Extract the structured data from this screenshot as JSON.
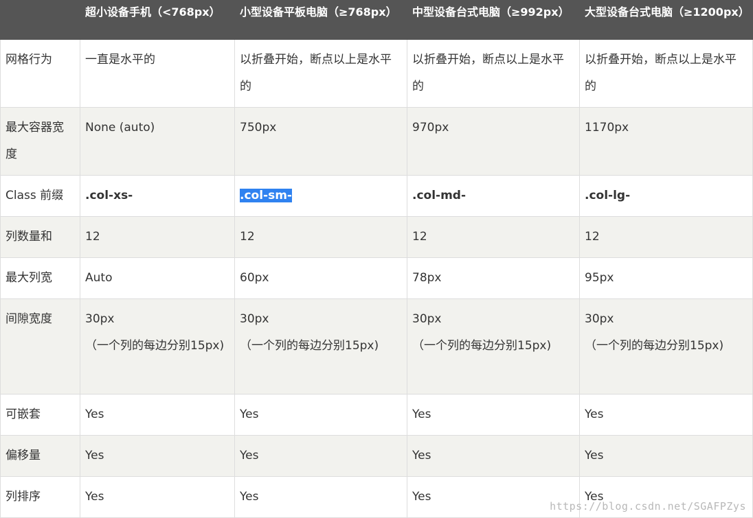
{
  "table": {
    "headers": [
      "",
      "超小设备手机（<768px）",
      "小型设备平板电脑（≥768px）",
      "中型设备台式电脑（≥992px）",
      "大型设备台式电脑（≥1200px）"
    ],
    "rows": [
      {
        "label": "网格行为",
        "cells": [
          "一直是水平的",
          "以折叠开始，断点以上是水平的",
          "以折叠开始，断点以上是水平的",
          "以折叠开始，断点以上是水平的"
        ]
      },
      {
        "label": "最大容器宽度",
        "cells": [
          "None (auto)",
          "750px",
          "970px",
          "1170px"
        ]
      },
      {
        "label": "Class 前缀",
        "cells": [
          ".col-xs-",
          ".col-sm-",
          ".col-md-",
          ".col-lg-"
        ],
        "selected_cell": ".col-sm-"
      },
      {
        "label": "列数量和",
        "cells": [
          "12",
          "12",
          "12",
          "12"
        ]
      },
      {
        "label": "最大列宽",
        "cells": [
          "Auto",
          "60px",
          "78px",
          "95px"
        ]
      },
      {
        "label": "间隙宽度",
        "cells": [
          "30px",
          "30px",
          "30px",
          "30px"
        ],
        "sub": "（一个列的每边分别15px)"
      },
      {
        "label": "可嵌套",
        "cells": [
          "Yes",
          "Yes",
          "Yes",
          "Yes"
        ]
      },
      {
        "label": "偏移量",
        "cells": [
          "Yes",
          "Yes",
          "Yes",
          "Yes"
        ]
      },
      {
        "label": "列排序",
        "cells": [
          "Yes",
          "Yes",
          "Yes",
          "Yes"
        ]
      }
    ]
  },
  "watermark": "https://blog.csdn.net/SGAFPZys",
  "colors": {
    "header_bg": "#555555",
    "header_text": "#ffffff",
    "row_alt_bg": "#f2f2ee",
    "border": "#dddddd",
    "selection": "#2f82f0"
  }
}
